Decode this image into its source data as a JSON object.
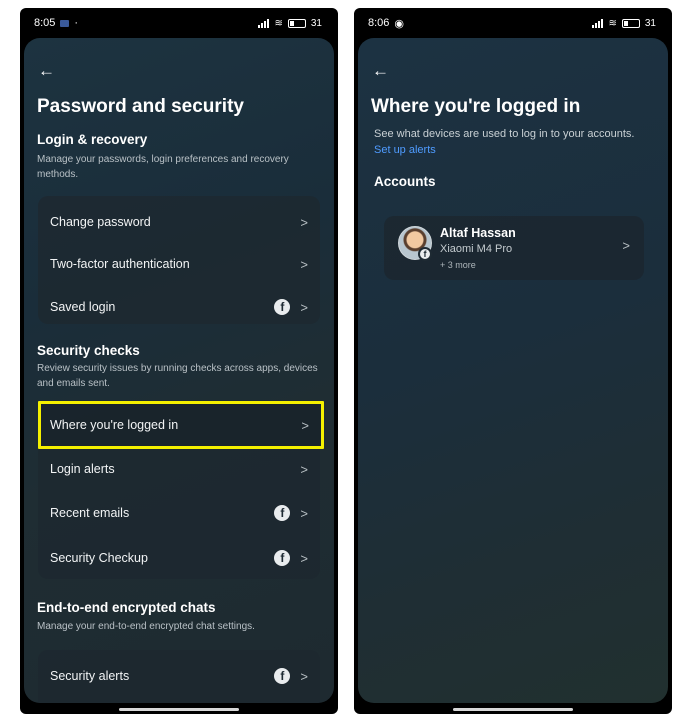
{
  "left": {
    "status": {
      "time": "8:05",
      "battery": "31"
    },
    "back_icon": "←",
    "title": "Password and security",
    "login_recovery": {
      "title": "Login & recovery",
      "desc": "Manage your passwords, login preferences and recovery methods.",
      "items": [
        {
          "label": "Change password",
          "fb": false
        },
        {
          "label": "Two-factor authentication",
          "fb": false
        },
        {
          "label": "Saved login",
          "fb": true
        }
      ]
    },
    "security_checks": {
      "title": "Security checks",
      "desc": "Review security issues by running checks across apps, devices and emails sent.",
      "items": [
        {
          "label": "Where you're logged in",
          "fb": false,
          "highlighted": true
        },
        {
          "label": "Login alerts",
          "fb": false
        },
        {
          "label": "Recent emails",
          "fb": true
        },
        {
          "label": "Security Checkup",
          "fb": true
        }
      ]
    },
    "e2e": {
      "title": "End-to-end encrypted chats",
      "desc": "Manage your end-to-end encrypted chat settings.",
      "items": [
        {
          "label": "Security alerts",
          "fb": true
        }
      ]
    },
    "highlight_color": "#f4f000"
  },
  "right": {
    "status": {
      "time": "8:06",
      "battery": "31"
    },
    "back_icon": "←",
    "title": "Where you're logged in",
    "desc": "See what devices are used to log in to your accounts.",
    "link": "Set up alerts",
    "accounts_title": "Accounts",
    "account": {
      "name": "Altaf Hassan",
      "device": "Xiaomi M4 Pro",
      "more": "+ 3 more"
    }
  },
  "chevron": ">",
  "fb_glyph": "f",
  "colors": {
    "link": "#4f9bff",
    "background": "#1d3340"
  }
}
